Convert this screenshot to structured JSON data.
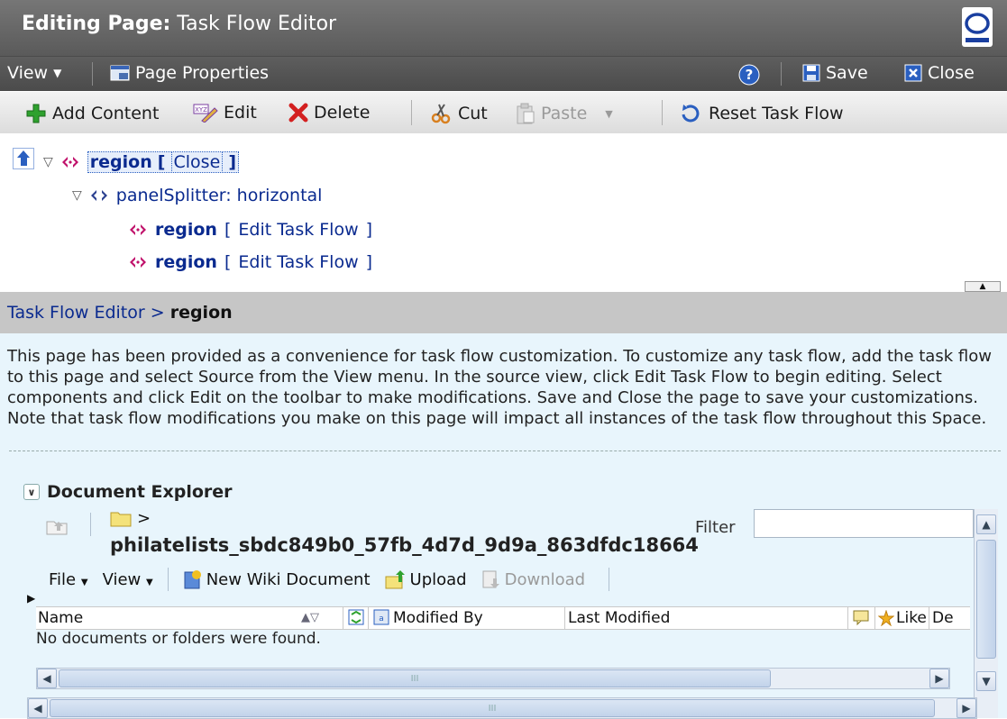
{
  "title_bar": {
    "label": "Editing Page:",
    "page_name": "Task Flow Editor"
  },
  "view_bar": {
    "view_label": "View",
    "page_properties_label": "Page Properties",
    "save_label": "Save",
    "close_label": "Close"
  },
  "toolbar": {
    "add_content": "Add Content",
    "edit": "Edit",
    "delete": "Delete",
    "cut": "Cut",
    "paste": "Paste",
    "reset_task_flow": "Reset Task Flow"
  },
  "tree": {
    "root": {
      "name": "region",
      "open_bracket": "[",
      "close_link": "Close",
      "close_bracket": "]"
    },
    "splitter": {
      "name": "panelSplitter: horizontal"
    },
    "children": [
      {
        "name": "region",
        "open_bracket": "[",
        "link": "Edit Task Flow",
        "close_bracket": "]"
      },
      {
        "name": "region",
        "open_bracket": "[",
        "link": "Edit Task Flow",
        "close_bracket": "]"
      }
    ]
  },
  "breadcrumb": {
    "parent": "Task Flow Editor",
    "separator": ">",
    "current": "region"
  },
  "info_text": "This page has been provided as a convenience for task flow customization. To customize any task flow, add the task flow to this page and select Source from the View menu. In the source view, click Edit Task Flow to begin editing. Select components and click Edit on the toolbar to make modifications. Save and Close the page to save your customizations. Note that task flow modifications you make on this page will impact all instances of the task flow throughout this Space.",
  "document_explorer": {
    "title": "Document Explorer",
    "path_separator": ">",
    "folder_path": "philatelists_sbdc849b0_57fb_4d7d_9d9a_863dfdc18664",
    "filter_label": "Filter",
    "filter_value": "",
    "menu_file": "File",
    "menu_view": "View",
    "new_wiki_document": "New Wiki Document",
    "upload": "Upload",
    "download": "Download",
    "columns": {
      "name": "Name",
      "modified_by": "Modified By",
      "last_modified": "Last Modified",
      "like": "Like",
      "de": "De"
    },
    "empty_message": "No documents or folders were found.",
    "scroll_grip": "III"
  },
  "colors": {
    "title_bg": "#6a6a6a",
    "link": "#0a2a8f",
    "region_icon": "#c0106a",
    "info_bg": "#e8f5fc",
    "crumb_bg": "#c6c6c6"
  }
}
